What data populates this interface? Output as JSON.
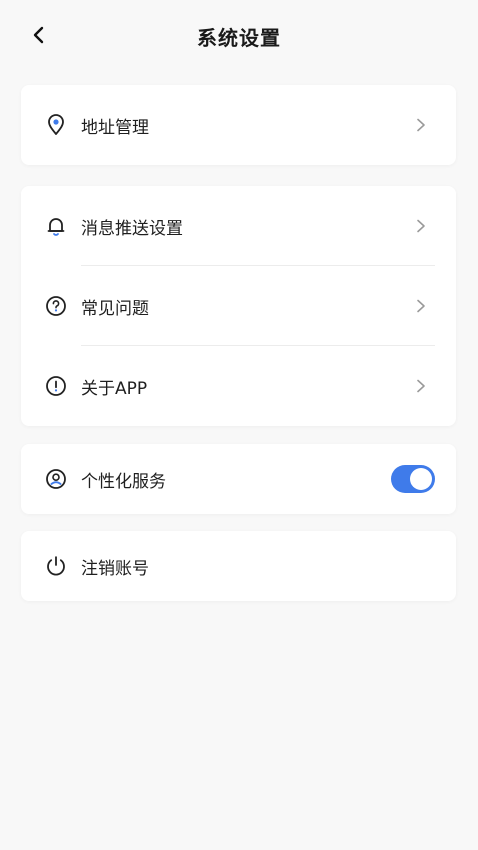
{
  "header": {
    "title": "系统设置",
    "back_icon": "chevron-left-icon"
  },
  "sections": {
    "address": {
      "label": "地址管理",
      "icon": "location-pin-icon"
    },
    "push": {
      "label": "消息推送设置",
      "icon": "bell-icon"
    },
    "faq": {
      "label": "常见问题",
      "icon": "question-circle-icon"
    },
    "about": {
      "label": "关于APP",
      "icon": "info-circle-icon"
    },
    "personalized": {
      "label": "个性化服务",
      "icon": "user-circle-icon",
      "toggle_on": true
    },
    "logout": {
      "label": "注销账号",
      "icon": "power-icon"
    }
  },
  "colors": {
    "accent": "#3f7bea",
    "background": "#f8f8f8",
    "card": "#ffffff"
  }
}
